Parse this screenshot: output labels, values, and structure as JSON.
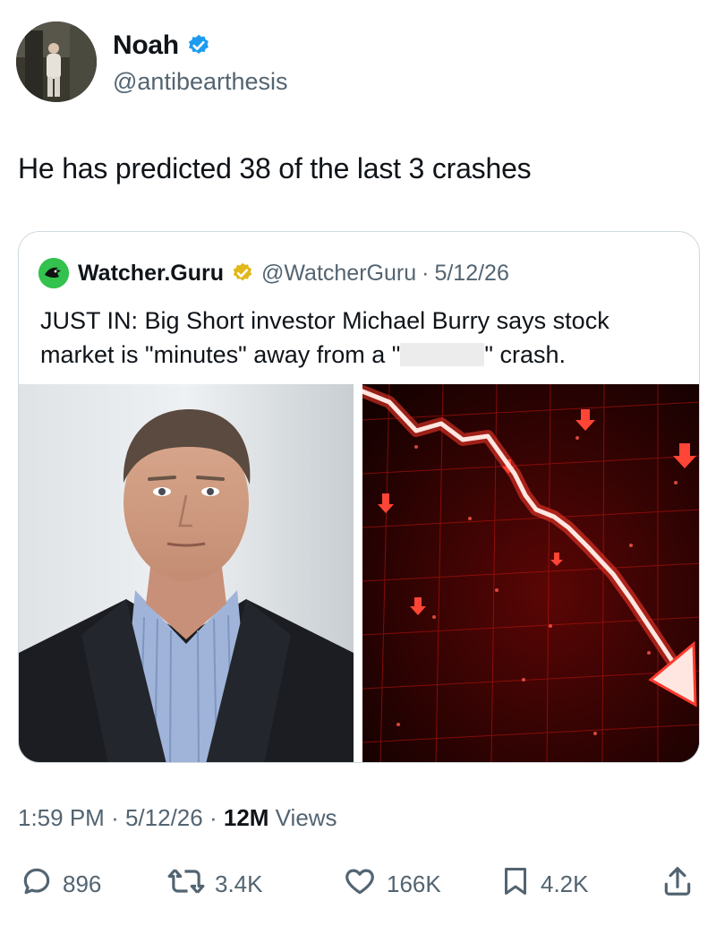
{
  "author": {
    "display_name": "Noah",
    "handle": "@antibearthesis",
    "verified": true
  },
  "tweet": {
    "text": "He has predicted 38 of the last 3 crashes"
  },
  "quoted_tweet": {
    "display_name": "Watcher.Guru",
    "handle": "@WatcherGuru",
    "separator": "·",
    "date": "5/12/26",
    "text_part1": "JUST IN: Big Short investor Michael Burry says stock market is \"minutes\" away from a \"",
    "text_part2": "\" crash."
  },
  "meta": {
    "time": "1:59 PM",
    "separator": "·",
    "date": "5/12/26",
    "views_count": "12M",
    "views_label": "Views"
  },
  "actions": {
    "replies": "896",
    "reposts": "3.4K",
    "likes": "166K",
    "bookmarks": "4.2K"
  },
  "colors": {
    "text": "#0f1419",
    "secondary": "#536471",
    "verified_blue": "#1d9bf0",
    "verified_gold": "#e2b719",
    "border": "#cfd9de",
    "brand_green": "#32c24d",
    "chart_red": "#ff2a1f"
  },
  "icons": {
    "verified": "verified-badge-icon",
    "reply": "reply-icon",
    "repost": "repost-icon",
    "like": "heart-icon",
    "bookmark": "bookmark-icon",
    "share": "share-icon"
  }
}
